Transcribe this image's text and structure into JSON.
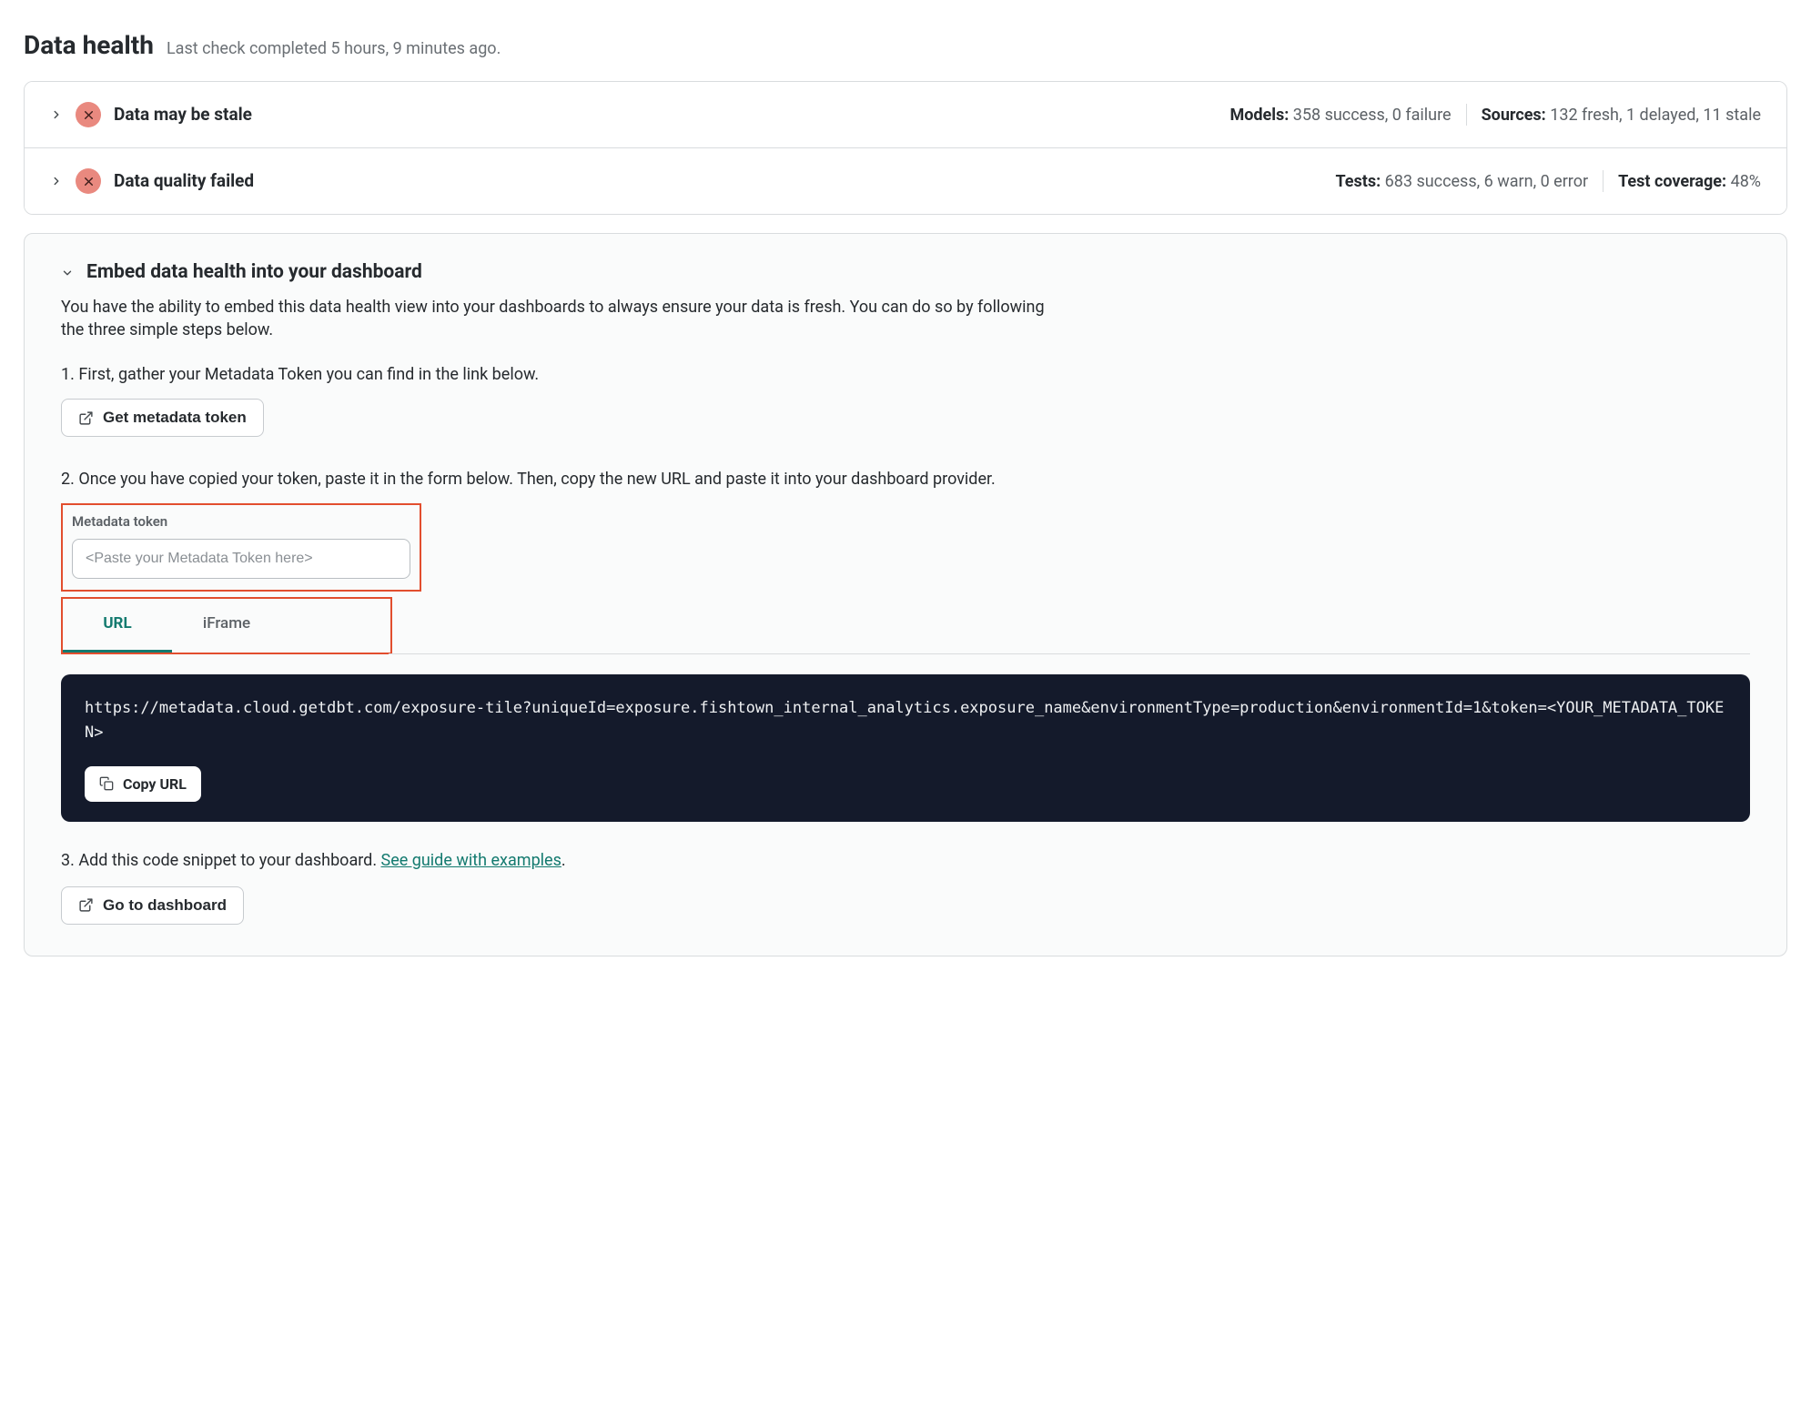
{
  "header": {
    "title": "Data health",
    "subtitle": "Last check completed 5 hours, 9 minutes ago."
  },
  "rows": [
    {
      "title": "Data may be stale",
      "models_label": "Models:",
      "models_value": "358 success, 0 failure",
      "sources_label": "Sources:",
      "sources_value": "132 fresh, 1 delayed, 11 stale"
    },
    {
      "title": "Data quality failed",
      "tests_label": "Tests:",
      "tests_value": "683 success, 6 warn, 0 error",
      "coverage_label": "Test coverage:",
      "coverage_value": "48%"
    }
  ],
  "embed": {
    "title": "Embed data health into your dashboard",
    "description": "You have the ability to embed this data health view into your dashboards to always ensure your data is fresh. You can do so by following the three simple steps below.",
    "step1": "1. First, gather your Metadata Token you can find in the link below.",
    "get_token_label": "Get metadata token",
    "step2": "2. Once you have copied your token, paste it in the form below. Then, copy the new URL and paste it into your dashboard provider.",
    "token_field_label": "Metadata token",
    "token_placeholder": "<Paste your Metadata Token here>",
    "tabs": {
      "url": "URL",
      "iframe": "iFrame"
    },
    "code_url": "https://metadata.cloud.getdbt.com/exposure-tile?uniqueId=exposure.fishtown_internal_analytics.exposure_name&environmentType=production&environmentId=1&token=<YOUR_METADATA_TOKEN>",
    "copy_label": "Copy URL",
    "step3_prefix": "3. Add this code snippet to your dashboard. ",
    "step3_link": "See guide with examples",
    "step3_suffix": ".",
    "dashboard_label": "Go to dashboard"
  }
}
